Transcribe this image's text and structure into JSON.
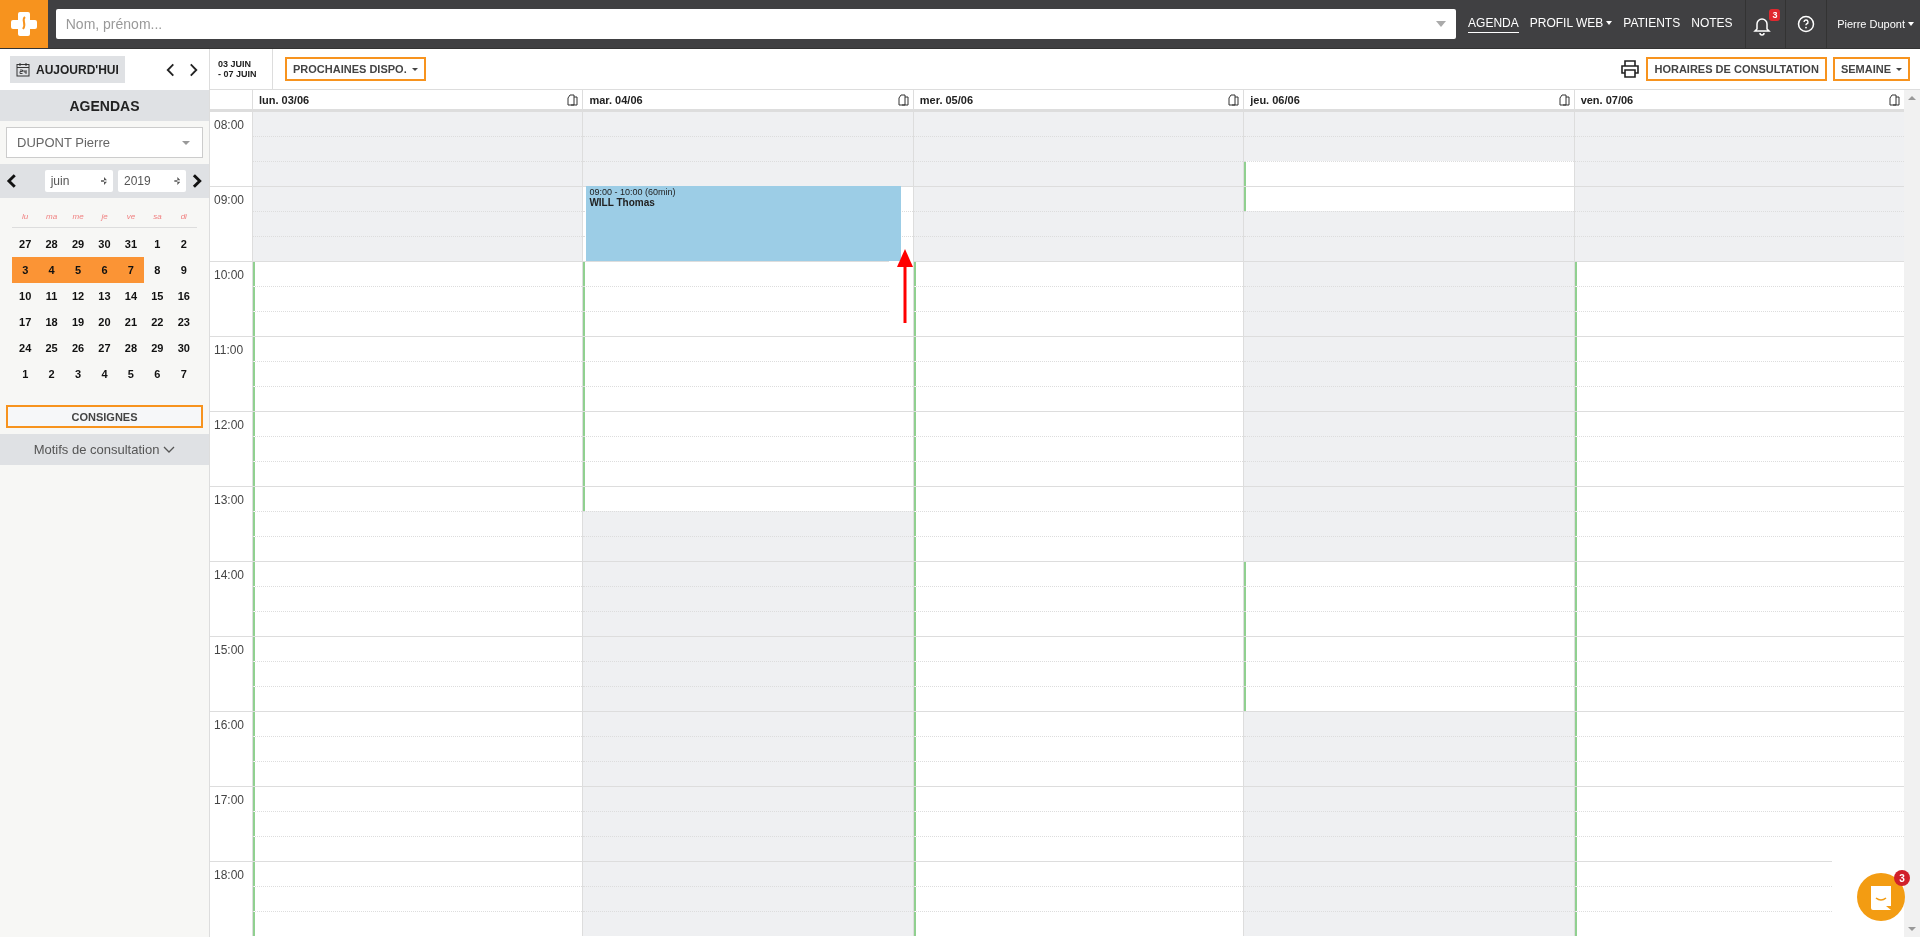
{
  "topbar": {
    "search": {
      "placeholder": "Nom, prénom..."
    },
    "nav": [
      {
        "label": "AGENDA",
        "selected": true,
        "dropdown": false
      },
      {
        "label": "PROFIL WEB",
        "selected": false,
        "dropdown": true
      },
      {
        "label": "PATIENTS",
        "selected": false,
        "dropdown": false
      },
      {
        "label": "NOTES",
        "selected": false,
        "dropdown": false
      }
    ],
    "notifications": {
      "count": "3"
    },
    "user": {
      "name": "Pierre Dupont"
    }
  },
  "sidebar": {
    "today_button": "AUJOURD'HUI",
    "section_title": "AGENDAS",
    "agenda_select": {
      "value": "DUPONT Pierre"
    },
    "month_select": {
      "value": "juin"
    },
    "year_select": {
      "value": "2019"
    },
    "weekdays": [
      "lu",
      "ma",
      "me",
      "je",
      "ve",
      "sa",
      "di"
    ],
    "weeks": [
      [
        {
          "label": "27",
          "selected": false
        },
        {
          "label": "28",
          "selected": false
        },
        {
          "label": "29",
          "selected": false
        },
        {
          "label": "30",
          "selected": false
        },
        {
          "label": "31",
          "selected": false
        },
        {
          "label": "1",
          "selected": false
        },
        {
          "label": "2",
          "selected": false
        }
      ],
      [
        {
          "label": "3",
          "selected": true
        },
        {
          "label": "4",
          "selected": true
        },
        {
          "label": "5",
          "selected": true
        },
        {
          "label": "6",
          "selected": true
        },
        {
          "label": "7",
          "selected": true
        },
        {
          "label": "8",
          "selected": false
        },
        {
          "label": "9",
          "selected": false
        }
      ],
      [
        {
          "label": "10",
          "selected": false
        },
        {
          "label": "11",
          "selected": false
        },
        {
          "label": "12",
          "selected": false
        },
        {
          "label": "13",
          "selected": false
        },
        {
          "label": "14",
          "selected": false
        },
        {
          "label": "15",
          "selected": false
        },
        {
          "label": "16",
          "selected": false
        }
      ],
      [
        {
          "label": "17",
          "selected": false
        },
        {
          "label": "18",
          "selected": false
        },
        {
          "label": "19",
          "selected": false
        },
        {
          "label": "20",
          "selected": false
        },
        {
          "label": "21",
          "selected": false
        },
        {
          "label": "22",
          "selected": false
        },
        {
          "label": "23",
          "selected": false
        }
      ],
      [
        {
          "label": "24",
          "selected": false
        },
        {
          "label": "25",
          "selected": false
        },
        {
          "label": "26",
          "selected": false
        },
        {
          "label": "27",
          "selected": false
        },
        {
          "label": "28",
          "selected": false
        },
        {
          "label": "29",
          "selected": false
        },
        {
          "label": "30",
          "selected": false
        }
      ],
      [
        {
          "label": "1",
          "selected": false
        },
        {
          "label": "2",
          "selected": false
        },
        {
          "label": "3",
          "selected": false
        },
        {
          "label": "4",
          "selected": false
        },
        {
          "label": "5",
          "selected": false
        },
        {
          "label": "6",
          "selected": false
        },
        {
          "label": "7",
          "selected": false
        }
      ]
    ],
    "consignes_button": "CONSIGNES",
    "motifs_toggle": {
      "label": "Motifs de consultation",
      "expanded": false
    }
  },
  "toolbar": {
    "range": [
      "03 JUIN",
      "- 07 JUIN"
    ],
    "next_slots_button": "PROCHAINES DISPO.",
    "hours_button": "HORAIRES DE CONSULTATION",
    "view_button": "SEMAINE"
  },
  "calendar": {
    "hours": [
      "08:00",
      "09:00",
      "10:00",
      "11:00",
      "12:00",
      "13:00",
      "14:00",
      "15:00",
      "16:00",
      "17:00",
      "18:00"
    ],
    "days": [
      {
        "label": "lun. 03/06",
        "slots": [
          {
            "kind": "closed"
          },
          {
            "kind": "closed"
          },
          {
            "kind": "closed"
          },
          {
            "kind": "closed"
          },
          {
            "kind": "closed"
          },
          {
            "kind": "closed"
          },
          {
            "kind": "open"
          },
          {
            "kind": "open"
          },
          {
            "kind": "open"
          },
          {
            "kind": "open"
          },
          {
            "kind": "open"
          },
          {
            "kind": "open"
          },
          {
            "kind": "open"
          },
          {
            "kind": "open"
          },
          {
            "kind": "open"
          },
          {
            "kind": "open"
          },
          {
            "kind": "open"
          },
          {
            "kind": "open"
          },
          {
            "kind": "open"
          },
          {
            "kind": "open"
          },
          {
            "kind": "open"
          },
          {
            "kind": "open"
          },
          {
            "kind": "open"
          },
          {
            "kind": "open"
          },
          {
            "kind": "open"
          },
          {
            "kind": "open"
          },
          {
            "kind": "open"
          },
          {
            "kind": "open"
          },
          {
            "kind": "open"
          },
          {
            "kind": "open"
          },
          {
            "kind": "open"
          },
          {
            "kind": "open"
          },
          {
            "kind": "open"
          }
        ]
      },
      {
        "label": "mar. 04/06",
        "slots": [
          {
            "kind": "closed"
          },
          {
            "kind": "closed"
          },
          {
            "kind": "closed"
          },
          {
            "kind": "booked"
          },
          {
            "kind": "booked"
          },
          {
            "kind": "booked"
          },
          {
            "kind": "open"
          },
          {
            "kind": "open"
          },
          {
            "kind": "open"
          },
          {
            "kind": "open"
          },
          {
            "kind": "open"
          },
          {
            "kind": "open"
          },
          {
            "kind": "open"
          },
          {
            "kind": "open"
          },
          {
            "kind": "open"
          },
          {
            "kind": "open"
          },
          {
            "kind": "closed"
          },
          {
            "kind": "closed"
          },
          {
            "kind": "closed"
          },
          {
            "kind": "closed"
          },
          {
            "kind": "closed"
          },
          {
            "kind": "closed"
          },
          {
            "kind": "closed"
          },
          {
            "kind": "closed"
          },
          {
            "kind": "closed"
          },
          {
            "kind": "closed"
          },
          {
            "kind": "closed"
          },
          {
            "kind": "closed"
          },
          {
            "kind": "closed"
          },
          {
            "kind": "closed"
          },
          {
            "kind": "closed"
          },
          {
            "kind": "closed"
          },
          {
            "kind": "closed"
          }
        ],
        "events": [
          {
            "time": "09:00 - 10:00 (60min)",
            "patient": "WILL Thomas"
          }
        ]
      },
      {
        "label": "mer. 05/06",
        "slots": [
          {
            "kind": "closed"
          },
          {
            "kind": "closed"
          },
          {
            "kind": "closed"
          },
          {
            "kind": "closed"
          },
          {
            "kind": "closed"
          },
          {
            "kind": "closed"
          },
          {
            "kind": "open"
          },
          {
            "kind": "open"
          },
          {
            "kind": "open"
          },
          {
            "kind": "open"
          },
          {
            "kind": "open"
          },
          {
            "kind": "open"
          },
          {
            "kind": "open"
          },
          {
            "kind": "open"
          },
          {
            "kind": "open"
          },
          {
            "kind": "open"
          },
          {
            "kind": "open"
          },
          {
            "kind": "open"
          },
          {
            "kind": "open"
          },
          {
            "kind": "open"
          },
          {
            "kind": "open"
          },
          {
            "kind": "open"
          },
          {
            "kind": "open"
          },
          {
            "kind": "open"
          },
          {
            "kind": "open"
          },
          {
            "kind": "open"
          },
          {
            "kind": "open"
          },
          {
            "kind": "open"
          },
          {
            "kind": "open"
          },
          {
            "kind": "open"
          },
          {
            "kind": "open"
          },
          {
            "kind": "open"
          },
          {
            "kind": "open"
          }
        ]
      },
      {
        "label": "jeu. 06/06",
        "slots": [
          {
            "kind": "closed"
          },
          {
            "kind": "closed"
          },
          {
            "kind": "open"
          },
          {
            "kind": "open"
          },
          {
            "kind": "closed"
          },
          {
            "kind": "closed"
          },
          {
            "kind": "closed"
          },
          {
            "kind": "closed"
          },
          {
            "kind": "closed"
          },
          {
            "kind": "closed"
          },
          {
            "kind": "closed"
          },
          {
            "kind": "closed"
          },
          {
            "kind": "closed"
          },
          {
            "kind": "closed"
          },
          {
            "kind": "closed"
          },
          {
            "kind": "closed"
          },
          {
            "kind": "closed"
          },
          {
            "kind": "closed"
          },
          {
            "kind": "open"
          },
          {
            "kind": "open"
          },
          {
            "kind": "open"
          },
          {
            "kind": "open"
          },
          {
            "kind": "open"
          },
          {
            "kind": "open"
          },
          {
            "kind": "closed"
          },
          {
            "kind": "closed"
          },
          {
            "kind": "closed"
          },
          {
            "kind": "closed"
          },
          {
            "kind": "closed"
          },
          {
            "kind": "closed"
          },
          {
            "kind": "closed"
          },
          {
            "kind": "closed"
          },
          {
            "kind": "closed"
          }
        ]
      },
      {
        "label": "ven. 07/06",
        "slots": [
          {
            "kind": "closed"
          },
          {
            "kind": "closed"
          },
          {
            "kind": "closed"
          },
          {
            "kind": "closed"
          },
          {
            "kind": "closed"
          },
          {
            "kind": "closed"
          },
          {
            "kind": "open"
          },
          {
            "kind": "open"
          },
          {
            "kind": "open"
          },
          {
            "kind": "open"
          },
          {
            "kind": "open"
          },
          {
            "kind": "open"
          },
          {
            "kind": "open"
          },
          {
            "kind": "open"
          },
          {
            "kind": "open"
          },
          {
            "kind": "open"
          },
          {
            "kind": "open"
          },
          {
            "kind": "open"
          },
          {
            "kind": "open"
          },
          {
            "kind": "open"
          },
          {
            "kind": "open"
          },
          {
            "kind": "open"
          },
          {
            "kind": "open"
          },
          {
            "kind": "open"
          },
          {
            "kind": "open"
          },
          {
            "kind": "open"
          },
          {
            "kind": "open"
          },
          {
            "kind": "open"
          },
          {
            "kind": "open"
          },
          {
            "kind": "open"
          },
          {
            "kind": "open"
          },
          {
            "kind": "open"
          },
          {
            "kind": "open"
          }
        ]
      }
    ]
  },
  "chat": {
    "badge": "3"
  }
}
